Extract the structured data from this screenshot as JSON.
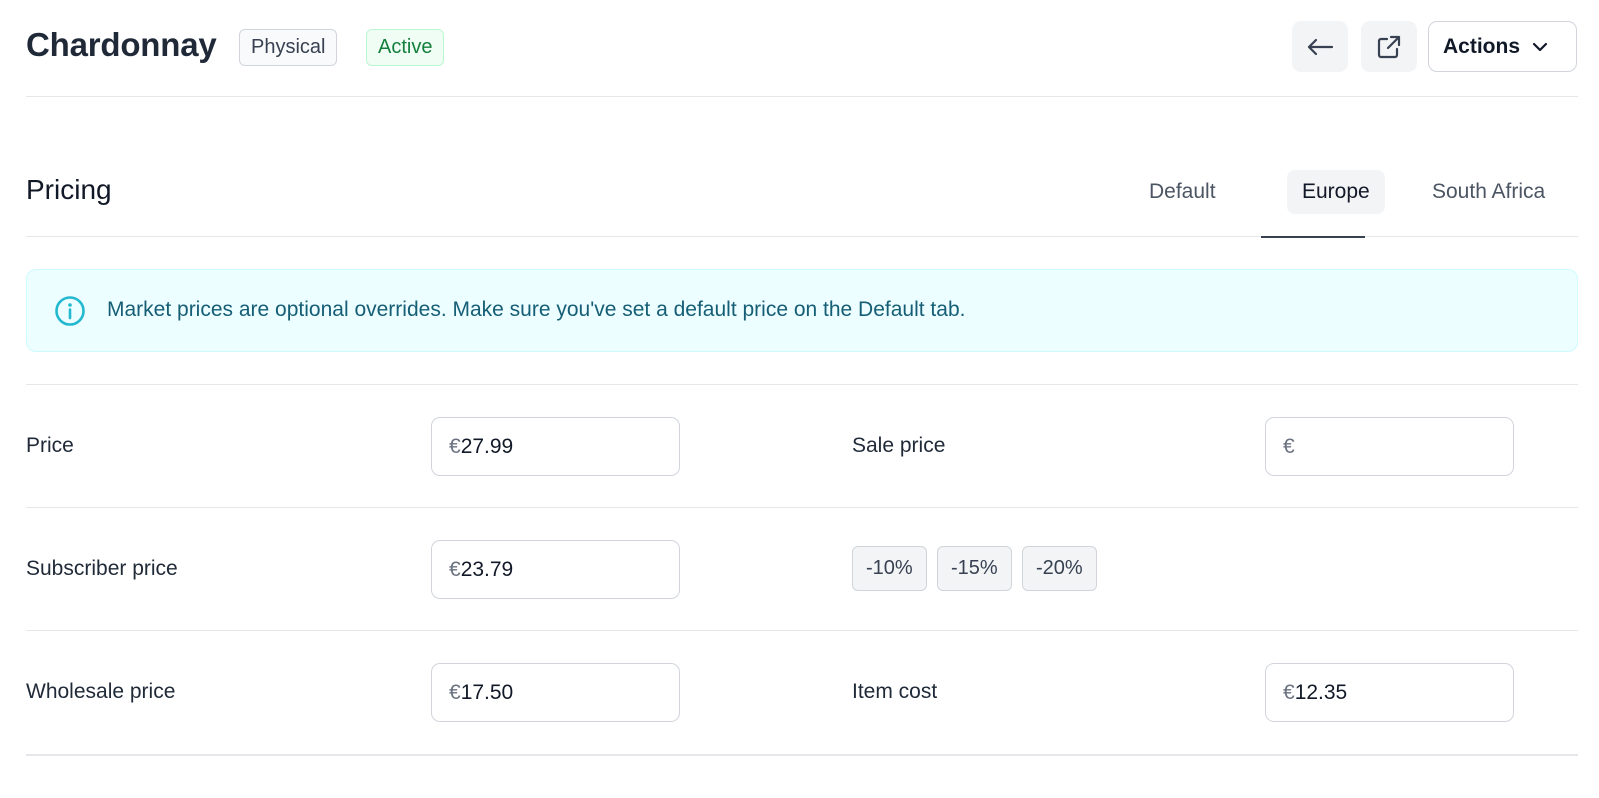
{
  "header": {
    "title": "Chardonnay",
    "badges": {
      "physical": "Physical",
      "active": "Active"
    },
    "back_icon": "arrow-left-icon",
    "external_icon": "external-link-icon",
    "actions_label": "Actions"
  },
  "pricing": {
    "title": "Pricing",
    "tabs": [
      {
        "label": "Default",
        "selected": false
      },
      {
        "label": "Europe",
        "selected": true
      },
      {
        "label": "South Africa",
        "selected": false
      }
    ],
    "notice": {
      "icon": "info-icon",
      "text": "Market prices are optional overrides. Make sure you've set a default price on the Default tab."
    },
    "currency_symbol": "€",
    "rows": {
      "price": {
        "label": "Price",
        "value": "27.99"
      },
      "sale_price": {
        "label": "Sale price",
        "value": ""
      },
      "subscriber_price": {
        "label": "Subscriber price",
        "value": "23.79"
      },
      "discounts": [
        "-10%",
        "-15%",
        "-20%"
      ],
      "wholesale_price": {
        "label": "Wholesale price",
        "value": "17.50"
      },
      "item_cost": {
        "label": "Item cost",
        "value": "12.35"
      }
    }
  },
  "colors": {
    "accent_active": "#15803d",
    "notice_bg": "#ecfeff",
    "notice_icon": "#06b6d4"
  }
}
